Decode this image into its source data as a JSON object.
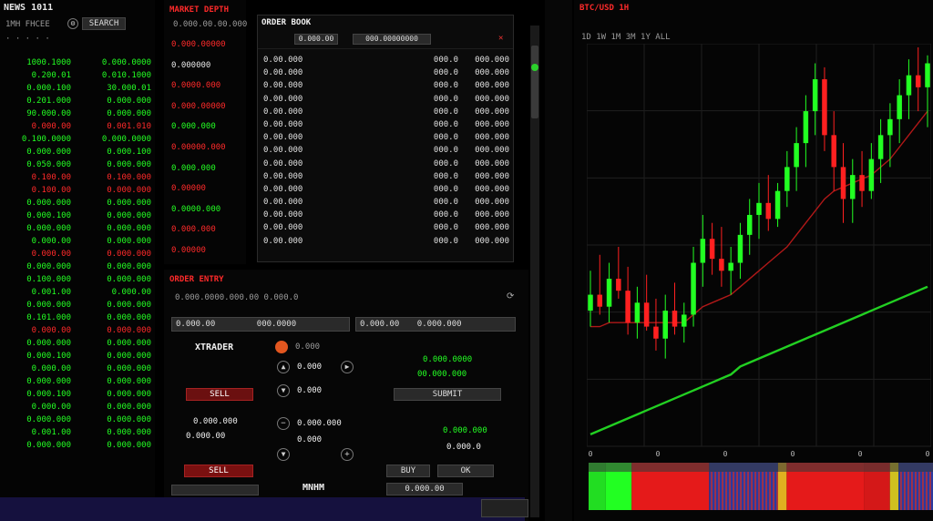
{
  "watchlist": {
    "title": "NEWS 1011",
    "status": "1MH FHCEE",
    "nav_hint": "· ·  ·  · ·",
    "search_label": "SEARCH",
    "rows": [
      {
        "left": "1000.1000",
        "right": "0.000.0000",
        "tone": "green"
      },
      {
        "left": "0.200.01",
        "right": "0.010.1000",
        "tone": "green"
      },
      {
        "left": "0.000.100",
        "right": "30.000.01",
        "tone": "green"
      },
      {
        "left": "0.201.000",
        "right": "0.000.000",
        "tone": "green"
      },
      {
        "left": "90.000.00",
        "right": "0.000.000",
        "tone": "green"
      },
      {
        "left": "0.000.00",
        "right": "0.001.010",
        "tone": "red"
      },
      {
        "left": "0.100.0000",
        "right": "0.000.0000",
        "tone": "green"
      },
      {
        "left": "0.000.000",
        "right": "0.000.100",
        "tone": "green"
      },
      {
        "left": "0.050.000",
        "right": "0.000.000",
        "tone": "green"
      },
      {
        "left": "0.100.00",
        "right": "0.100.000",
        "tone": "red"
      },
      {
        "left": "0.100.00",
        "right": "0.000.000",
        "tone": "red"
      },
      {
        "left": "0.000.000",
        "right": "0.000.000",
        "tone": "green"
      },
      {
        "left": "0.000.100",
        "right": "0.000.000",
        "tone": "green"
      },
      {
        "left": "0.000.000",
        "right": "0.000.000",
        "tone": "green"
      },
      {
        "left": "0.000.00",
        "right": "0.000.000",
        "tone": "green"
      },
      {
        "left": "0.000.00",
        "right": "0.000.000",
        "tone": "red"
      },
      {
        "left": "0.000.000",
        "right": "0.000.000",
        "tone": "green"
      },
      {
        "left": "0.100.000",
        "right": "0.000.000",
        "tone": "green"
      },
      {
        "left": "0.001.00",
        "right": "0.000.00",
        "tone": "green"
      },
      {
        "left": "0.000.000",
        "right": "0.000.000",
        "tone": "green"
      },
      {
        "left": "0.101.000",
        "right": "0.000.000",
        "tone": "green"
      },
      {
        "left": "0.000.00",
        "right": "0.000.000",
        "tone": "red"
      },
      {
        "left": "0.000.000",
        "right": "0.000.000",
        "tone": "green"
      },
      {
        "left": "0.000.100",
        "right": "0.000.000",
        "tone": "green"
      },
      {
        "left": "0.000.00",
        "right": "0.000.000",
        "tone": "green"
      },
      {
        "left": "0.000.000",
        "right": "0.000.000",
        "tone": "green"
      },
      {
        "left": "0.000.100",
        "right": "0.000.000",
        "tone": "green"
      },
      {
        "left": "0.000.00",
        "right": "0.000.000",
        "tone": "green"
      },
      {
        "left": "0.000.000",
        "right": "0.000.000",
        "tone": "green"
      },
      {
        "left": "0.001.00",
        "right": "0.000.000",
        "tone": "green"
      },
      {
        "left": "0.000.000",
        "right": "0.000.000",
        "tone": "green"
      }
    ],
    "footer": "· · ·  · ·  ·  ·  · ·"
  },
  "depth": {
    "title": "MARKET DEPTH",
    "subtitle": "0.000.00.00.000",
    "rows": [
      {
        "text": "0.000.00000",
        "tone": "red"
      },
      {
        "text": "0.000000",
        "tone": "white"
      },
      {
        "text": "0.0000.000",
        "tone": "red"
      },
      {
        "text": "0.000.00000",
        "tone": "red"
      },
      {
        "text": "0.000.000",
        "tone": "green"
      },
      {
        "text": "0.00000.000",
        "tone": "red"
      },
      {
        "text": "0.000.000",
        "tone": "green"
      },
      {
        "text": "0.00000",
        "tone": "red"
      },
      {
        "text": "0.0000.000",
        "tone": "green"
      },
      {
        "text": "0.000.000",
        "tone": "red"
      },
      {
        "text": "0.00000",
        "tone": "red"
      }
    ]
  },
  "orderbook": {
    "title": "ORDER BOOK",
    "tab1": "0.000.00",
    "tab2": "000.00000000",
    "rows": [
      {
        "a": "0.00.000",
        "b": "000.0",
        "c": "000.000"
      },
      {
        "a": "0.00.000",
        "b": "000.0",
        "c": "000.000"
      },
      {
        "a": "0.00.000",
        "b": "000.0",
        "c": "000.000"
      },
      {
        "a": "0.00.000",
        "b": "000.0",
        "c": "000.000"
      },
      {
        "a": "0.00.000",
        "b": "000.0",
        "c": "000.000"
      },
      {
        "a": "0.00.000",
        "b": "000.0",
        "c": "000.000"
      },
      {
        "a": "0.00.000",
        "b": "000.0",
        "c": "000.000"
      },
      {
        "a": "0.00.000",
        "b": "000.0",
        "c": "000.000"
      },
      {
        "a": "0.00.000",
        "b": "000.0",
        "c": "000.000"
      },
      {
        "a": "0.00.000",
        "b": "000.0",
        "c": "000.000"
      },
      {
        "a": "0.00.000",
        "b": "000.0",
        "c": "000.000"
      },
      {
        "a": "0.00.000",
        "b": "000.0",
        "c": "000.000"
      },
      {
        "a": "0.00.000",
        "b": "000.0",
        "c": "000.000"
      },
      {
        "a": "0.00.000",
        "b": "000.0",
        "c": "000.000"
      },
      {
        "a": "0.00.000",
        "b": "000.0",
        "c": "000.000"
      }
    ]
  },
  "order_entry": {
    "title": "ORDER ENTRY",
    "subtitle": "0.000.0000.000.00 0.000.0",
    "field_left": "0.000.00",
    "field_left_value": "000.0000",
    "field_right": "0.000.00",
    "field_right_value": "0.000.000",
    "brand": "XTRADER",
    "price_label": "0.000",
    "price_1": "0.000",
    "price_2": "0.000",
    "buy_label": "BUY",
    "bid_text": "0.000.0000",
    "bid_value": "00.000.000",
    "submit_label": "SUBMIT",
    "qty_left": "0.000.000",
    "qty_left_value": "0.000.00",
    "qty_mid": "0.000.000",
    "qty_mid_value": "0.000",
    "qty_right": "0.000.000",
    "qty_right_value": "0.000.0",
    "sell_label": "SELL",
    "footer_brand": "MNHM",
    "footer_value": "0.000.00",
    "ok_label": "OK"
  },
  "chart": {
    "title": "BTC/USD 1H",
    "toolbar": "1D 1W 1M 3M 1Y ALL"
  },
  "chart_data": {
    "type": "candlestick",
    "title": "",
    "xlabel": "",
    "ylabel": "",
    "x_tick_labels": [
      "0",
      "0",
      "0",
      "0",
      "0",
      "0"
    ],
    "ylim": [
      0,
      100
    ],
    "up_color": "#22ff22",
    "down_color": "#ff2020",
    "ma_fast_color": "#b01818",
    "ma_slow_color": "#22d022",
    "candles": [
      {
        "o": 34,
        "h": 44,
        "l": 30,
        "c": 38
      },
      {
        "o": 38,
        "h": 48,
        "l": 33,
        "c": 35
      },
      {
        "o": 35,
        "h": 46,
        "l": 31,
        "c": 42
      },
      {
        "o": 42,
        "h": 50,
        "l": 37,
        "c": 39
      },
      {
        "o": 39,
        "h": 45,
        "l": 28,
        "c": 31
      },
      {
        "o": 31,
        "h": 40,
        "l": 27,
        "c": 36
      },
      {
        "o": 36,
        "h": 43,
        "l": 29,
        "c": 30
      },
      {
        "o": 30,
        "h": 37,
        "l": 24,
        "c": 27
      },
      {
        "o": 27,
        "h": 38,
        "l": 22,
        "c": 34
      },
      {
        "o": 34,
        "h": 41,
        "l": 28,
        "c": 30
      },
      {
        "o": 30,
        "h": 36,
        "l": 26,
        "c": 33
      },
      {
        "o": 33,
        "h": 50,
        "l": 30,
        "c": 46
      },
      {
        "o": 46,
        "h": 58,
        "l": 40,
        "c": 52
      },
      {
        "o": 52,
        "h": 56,
        "l": 43,
        "c": 47
      },
      {
        "o": 47,
        "h": 55,
        "l": 40,
        "c": 44
      },
      {
        "o": 44,
        "h": 50,
        "l": 38,
        "c": 46
      },
      {
        "o": 46,
        "h": 56,
        "l": 42,
        "c": 53
      },
      {
        "o": 53,
        "h": 62,
        "l": 48,
        "c": 58
      },
      {
        "o": 58,
        "h": 66,
        "l": 52,
        "c": 61
      },
      {
        "o": 61,
        "h": 68,
        "l": 54,
        "c": 57
      },
      {
        "o": 57,
        "h": 66,
        "l": 55,
        "c": 64
      },
      {
        "o": 64,
        "h": 74,
        "l": 60,
        "c": 70
      },
      {
        "o": 70,
        "h": 80,
        "l": 64,
        "c": 76
      },
      {
        "o": 76,
        "h": 88,
        "l": 70,
        "c": 84
      },
      {
        "o": 84,
        "h": 96,
        "l": 78,
        "c": 92
      },
      {
        "o": 92,
        "h": 95,
        "l": 74,
        "c": 78
      },
      {
        "o": 78,
        "h": 84,
        "l": 64,
        "c": 70
      },
      {
        "o": 70,
        "h": 76,
        "l": 56,
        "c": 62
      },
      {
        "o": 62,
        "h": 72,
        "l": 56,
        "c": 68
      },
      {
        "o": 68,
        "h": 74,
        "l": 60,
        "c": 64
      },
      {
        "o": 64,
        "h": 76,
        "l": 62,
        "c": 72
      },
      {
        "o": 72,
        "h": 82,
        "l": 66,
        "c": 78
      },
      {
        "o": 78,
        "h": 86,
        "l": 70,
        "c": 82
      },
      {
        "o": 82,
        "h": 92,
        "l": 76,
        "c": 88
      },
      {
        "o": 88,
        "h": 97,
        "l": 82,
        "c": 93
      },
      {
        "o": 93,
        "h": 100,
        "l": 84,
        "c": 90
      },
      {
        "o": 90,
        "h": 98,
        "l": 80,
        "c": 96
      }
    ],
    "ma_fast": [
      30,
      30,
      31,
      31,
      31,
      31,
      31,
      31,
      31,
      31,
      31,
      33,
      35,
      36,
      37,
      38,
      40,
      42,
      44,
      46,
      48,
      50,
      53,
      56,
      59,
      62,
      64,
      65,
      66,
      67,
      68,
      70,
      72,
      75,
      78,
      81,
      84
    ],
    "ma_slow": [
      3,
      4,
      5,
      6,
      7,
      8,
      9,
      10,
      11,
      12,
      13,
      14,
      15,
      16,
      17,
      18,
      20,
      21,
      22,
      23,
      24,
      25,
      26,
      27,
      28,
      29,
      30,
      31,
      32,
      33,
      34,
      35,
      36,
      37,
      38,
      39,
      40
    ],
    "volume_strip": [
      {
        "value": 2,
        "color": "#22dd22"
      },
      {
        "value": 3,
        "color": "#22ff22"
      },
      {
        "value": 9,
        "color": "#e51a1a"
      },
      {
        "value": 8,
        "color": "#2a3aa0"
      },
      {
        "value": 1,
        "color": "#e0b020"
      },
      {
        "value": 9,
        "color": "#e51a1a"
      },
      {
        "value": 3,
        "color": "#d41818"
      },
      {
        "value": 1,
        "color": "#d0c020"
      },
      {
        "value": 4,
        "color": "#2a3aa0"
      }
    ]
  }
}
